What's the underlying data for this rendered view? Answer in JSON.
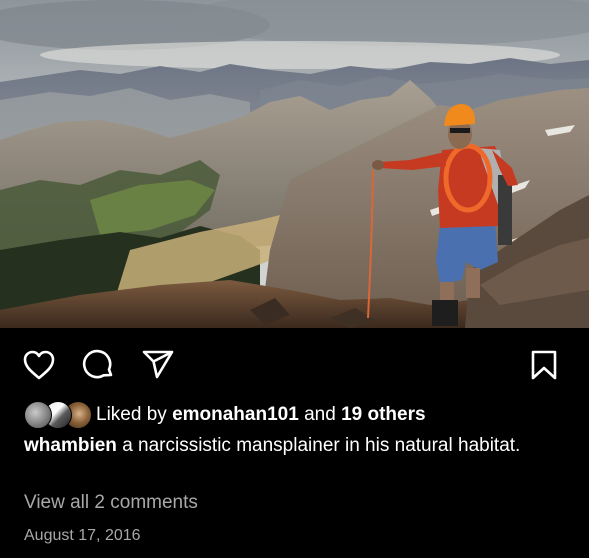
{
  "post": {
    "photo_alt": "",
    "likes": {
      "prefix": "Liked by",
      "username": "emonahan101",
      "joiner": "and",
      "others": "19 others"
    },
    "caption": {
      "username": "whambien",
      "text": "a narcissistic mansplainer in his natural habitat."
    },
    "view_comments": "View all 2 comments",
    "date": "August 17, 2016"
  },
  "icons": {
    "like": "heart-icon",
    "comment": "comment-bubble-icon",
    "share": "paper-plane-icon",
    "save": "bookmark-icon"
  },
  "colors": {
    "background": "#000000",
    "text": "#ffffff",
    "muted_text": "#a8a8a8"
  }
}
